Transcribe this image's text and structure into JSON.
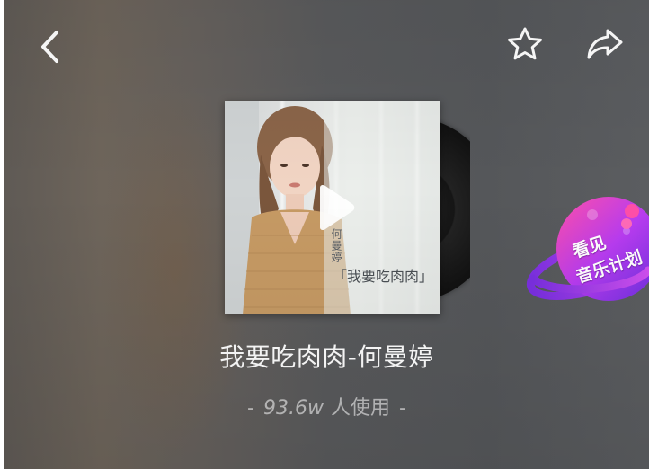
{
  "header": {
    "back_icon": "chevron-left-icon",
    "favorite_icon": "star-outline-icon",
    "share_icon": "share-arrow-icon"
  },
  "cover": {
    "artist_vertical": "何曼婷",
    "title_on_cover": "「我要吃肉肉」",
    "play_icon": "play-icon"
  },
  "song": {
    "title": "我要吃肉肉-何曼婷"
  },
  "usage": {
    "dash_left": "-",
    "count": "93.6w",
    "suffix": "人使用",
    "dash_right": "-"
  },
  "badge": {
    "line1": "看见",
    "line2": "音乐计划"
  },
  "colors": {
    "badge_primary": "#b83cf0",
    "badge_secondary": "#7a2fe0",
    "badge_accent": "#ff4fa8",
    "text_primary": "#ffffff"
  }
}
